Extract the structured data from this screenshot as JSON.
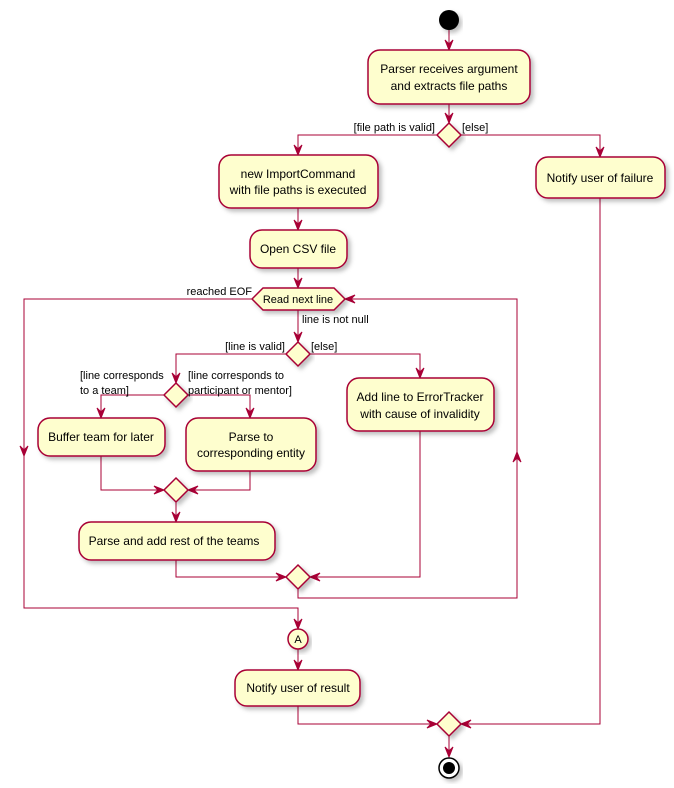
{
  "diagram": {
    "type": "activity-diagram",
    "colors": {
      "activity_fill": "#FEFECE",
      "border": "#A80036",
      "start_node": "#000000"
    },
    "activities": {
      "parser": [
        "Parser receives argument",
        "and extracts file paths"
      ],
      "import_command": [
        "new ImportCommand",
        "with file paths is executed"
      ],
      "notify_failure": [
        "Notify user of failure"
      ],
      "open_csv": [
        "Open CSV file"
      ],
      "read_next_line": [
        "Read next line"
      ],
      "buffer_team": [
        "Buffer team for later"
      ],
      "parse_entity": [
        "Parse to",
        "corresponding entity"
      ],
      "add_error": [
        "Add line to ErrorTracker",
        "with cause of invalidity"
      ],
      "parse_teams": [
        "Parse and add rest of the teams"
      ],
      "notify_result": [
        "Notify user of result"
      ]
    },
    "guards": {
      "file_valid": "[file path is valid]",
      "file_else": "[else]",
      "reached_eof": "reached EOF",
      "line_not_null": "line is not null",
      "line_valid": "[line is valid]",
      "line_else": "[else]",
      "team": [
        "[line corresponds",
        "to a team]"
      ],
      "participant": [
        "[line corresponds to",
        "participant or mentor]"
      ]
    },
    "connector_label": "A"
  }
}
